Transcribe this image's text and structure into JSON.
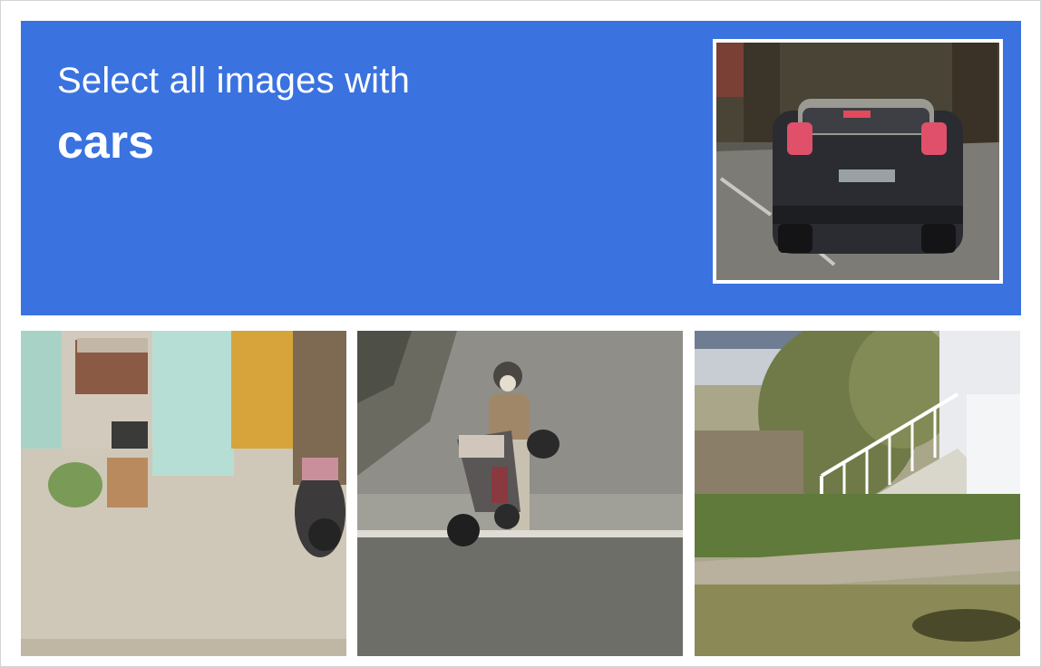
{
  "challenge": {
    "prompt": "Select all images with",
    "target": "cars"
  },
  "example_image": {
    "subject": "car-rear-view"
  },
  "tiles": [
    {
      "subject": "storefront-with-motorbike"
    },
    {
      "subject": "person-on-motorbike"
    },
    {
      "subject": "house-with-stairs"
    }
  ],
  "colors": {
    "header": "#3a72e0",
    "text": "#ffffff"
  }
}
